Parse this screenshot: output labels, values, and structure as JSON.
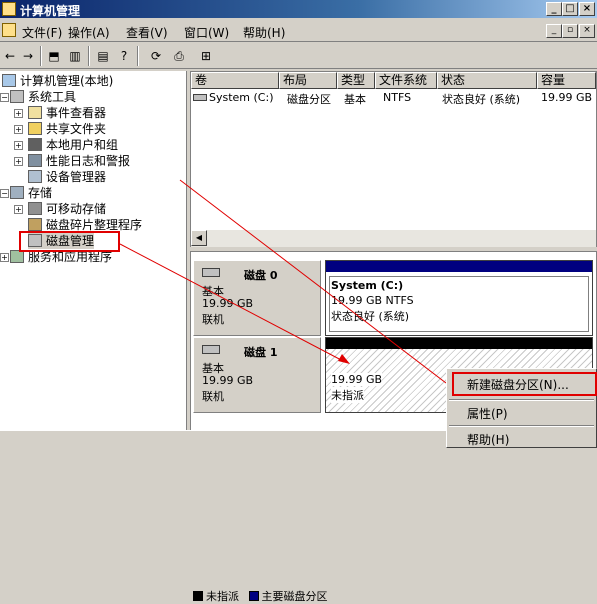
{
  "window": {
    "title": "计算机管理"
  },
  "menu": [
    {
      "label": "文件(F)"
    },
    {
      "label": "操作(A)"
    },
    {
      "label": "查看(V)"
    },
    {
      "label": "窗口(W)"
    },
    {
      "label": "帮助(H)"
    }
  ],
  "tree": {
    "root": "计算机管理(本地)",
    "system_tools": "系统工具",
    "event_viewer": "事件查看器",
    "shared_folders": "共享文件夹",
    "local_users": "本地用户和组",
    "perf_logs": "性能日志和警报",
    "device_manager": "设备管理器",
    "storage": "存储",
    "removable_storage": "可移动存储",
    "defrag": "磁盘碎片整理程序",
    "disk_management": "磁盘管理",
    "services_apps": "服务和应用程序"
  },
  "volume_list": {
    "columns": [
      "卷",
      "布局",
      "类型",
      "文件系统",
      "状态",
      "容量"
    ],
    "rows": [
      {
        "volume": "System (C:)",
        "layout": "磁盘分区",
        "type": "基本",
        "fs": "NTFS",
        "status": "状态良好 (系统)",
        "capacity": "19.99 GB"
      }
    ]
  },
  "disks": [
    {
      "name": "磁盘 0",
      "type": "基本",
      "size": "19.99 GB",
      "status": "联机",
      "volume": {
        "name": "System  (C:)",
        "detail": "19.99 GB NTFS",
        "status": "状态良好 (系统)"
      }
    },
    {
      "name": "磁盘 1",
      "type": "基本",
      "size": "19.99 GB",
      "status": "联机",
      "volume": {
        "detail": "19.99 GB",
        "status": "未指派"
      }
    }
  ],
  "legend": {
    "unallocated": "未指派",
    "primary": "主要磁盘分区"
  },
  "context_menu": {
    "new_partition": "新建磁盘分区(N)...",
    "properties": "属性(P)",
    "help": "帮助(H)"
  },
  "colors": {
    "unallocated": "#000000",
    "primary": "#000080",
    "highlight": "#e00000"
  }
}
